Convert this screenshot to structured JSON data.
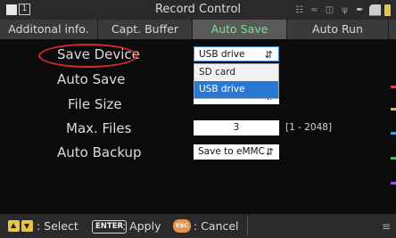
{
  "titlebar": {
    "title": "Record Control",
    "window_number": "1"
  },
  "tabs": [
    {
      "label": "Additonal info.",
      "active": false
    },
    {
      "label": "Capt. Buffer",
      "active": false
    },
    {
      "label": "Auto Save",
      "active": true
    },
    {
      "label": "Auto Run",
      "active": false
    }
  ],
  "form": {
    "save_device_label": "Save Device",
    "save_device_value": "USB drive",
    "save_device_options": [
      "SD card",
      "USB drive"
    ],
    "auto_save_label": "Auto Save",
    "file_size_label": "File Size",
    "max_files_label": "Max. Files",
    "max_files_value": "3",
    "max_files_range": "[1 - 2048]",
    "auto_backup_label": "Auto Backup",
    "auto_backup_value": "Save to eMMC"
  },
  "bottombar": {
    "select_label": ": Select",
    "enter_key": "ENTER",
    "apply_label": ": Apply",
    "esc_key": "ESC",
    "cancel_label": ": Cancel"
  },
  "colors": {
    "active_tab_text": "#7fe18f",
    "highlight_ring": "#d62a2a",
    "dropdown_selected": "#2b78d2",
    "keycap_yellow": "#e6c64a",
    "esc_orange": "#e9944a"
  },
  "icons": [
    "wifi-icon",
    "network-icon",
    "usb-icon",
    "sd-card-icon",
    "battery-icon",
    "menu-icon"
  ]
}
